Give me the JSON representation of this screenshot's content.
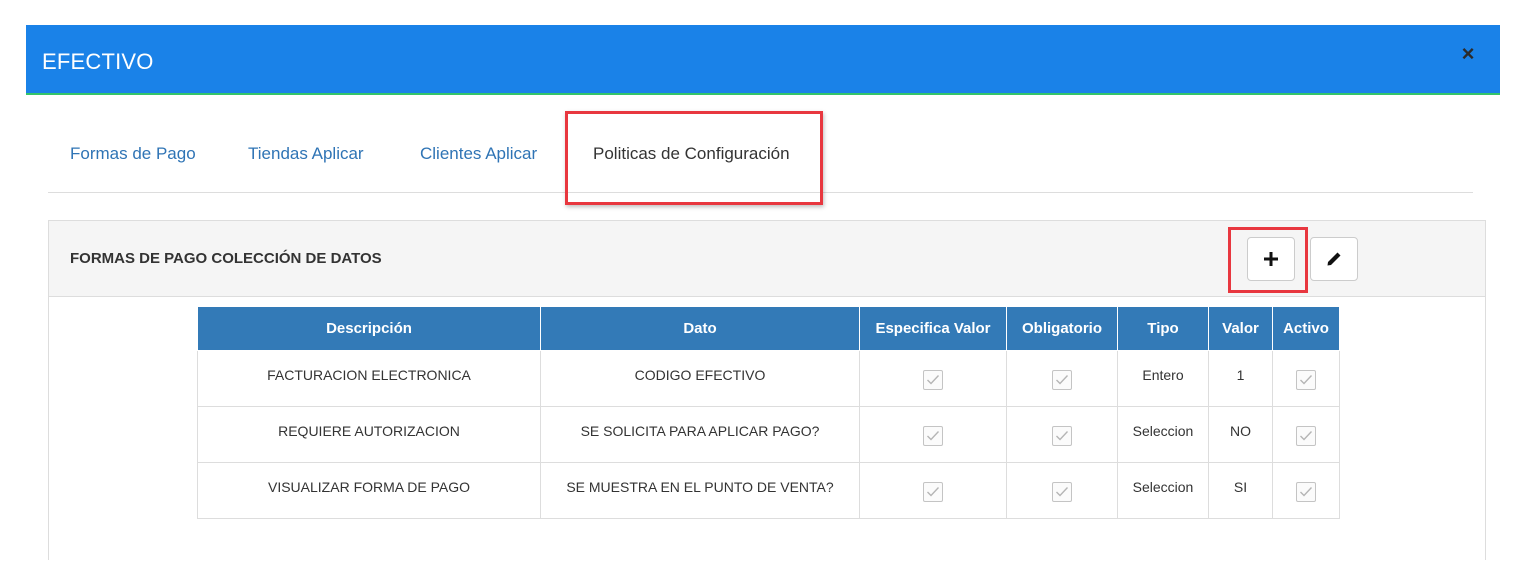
{
  "modal": {
    "title": "EFECTIVO",
    "close_label": "×"
  },
  "tabs": [
    {
      "label": "Formas de Pago"
    },
    {
      "label": "Tiendas Aplicar"
    },
    {
      "label": "Clientes Aplicar"
    },
    {
      "label": "Politicas de Configuración",
      "active": true
    }
  ],
  "panel": {
    "title": "FORMAS DE PAGO COLECCIÓN DE DATOS",
    "add_icon": "plus-icon",
    "edit_icon": "pencil-icon"
  },
  "table": {
    "headers": [
      "Descripción",
      "Dato",
      "Especifica Valor",
      "Obligatorio",
      "Tipo",
      "Valor",
      "Activo"
    ],
    "rows": [
      {
        "descripcion": "FACTURACION ELECTRONICA",
        "dato": "CODIGO EFECTIVO",
        "especifica_valor": true,
        "obligatorio": true,
        "tipo": "Entero",
        "valor": "1",
        "activo": true
      },
      {
        "descripcion": "REQUIERE AUTORIZACION",
        "dato": "SE SOLICITA PARA APLICAR PAGO?",
        "especifica_valor": true,
        "obligatorio": true,
        "tipo": "Seleccion",
        "valor": "NO",
        "activo": true
      },
      {
        "descripcion": "VISUALIZAR FORMA DE PAGO",
        "dato": "SE MUESTRA EN EL PUNTO DE VENTA?",
        "especifica_valor": true,
        "obligatorio": true,
        "tipo": "Seleccion",
        "valor": "SI",
        "activo": true
      }
    ]
  },
  "colors": {
    "header_bg": "#1a82e8",
    "table_header": "#337ab7",
    "highlight": "#e8373f",
    "link": "#2f74b5"
  }
}
